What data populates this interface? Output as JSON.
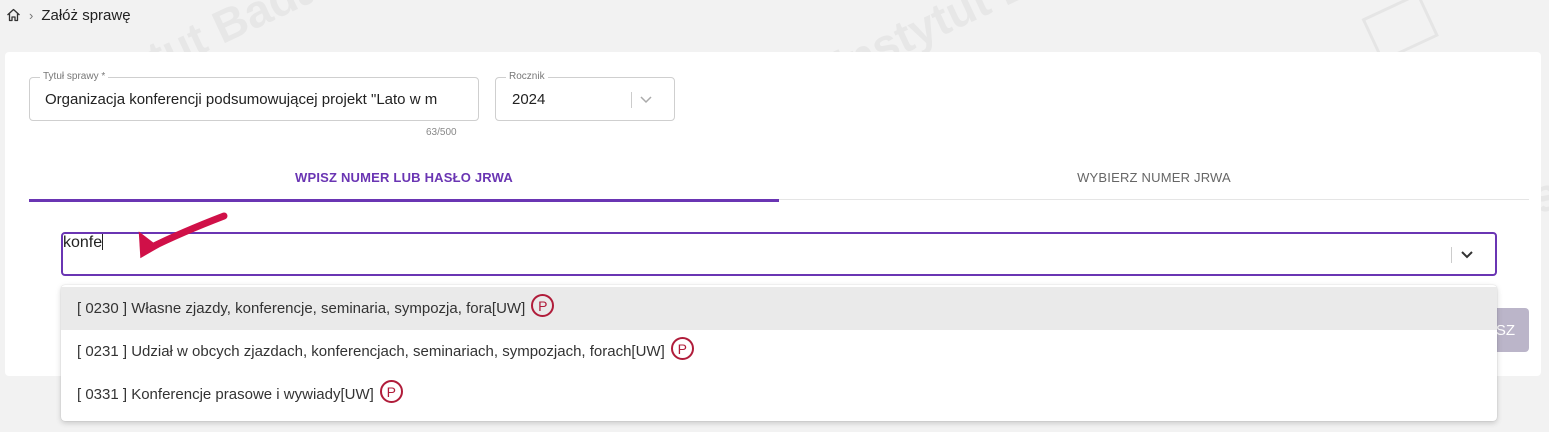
{
  "breadcrumb": {
    "current": "Załóż sprawę"
  },
  "form": {
    "title_label": "Tytuł sprawy *",
    "title_value": "Organizacja konferencji podsumowującej projekt \"Lato w m",
    "title_counter": "63/500",
    "year_label": "Rocznik",
    "year_value": "2024"
  },
  "tabs": [
    {
      "label": "WPISZ NUMER LUB HASŁO JRWA",
      "active": true
    },
    {
      "label": "WYBIERZ NUMER JRWA",
      "active": false
    }
  ],
  "search": {
    "value": "konfe"
  },
  "dropdown": {
    "options": [
      {
        "label": "[ 0230 ] Własne zjazdy, konferencje, seminaria, sympozja, fora[UW]",
        "badge": "P",
        "highlighted": true
      },
      {
        "label": "[ 0231 ] Udział w obcych zjazdach, konferencjach, seminariach, sympozjach, forach[UW]",
        "badge": "P",
        "highlighted": false
      },
      {
        "label": "[ 0331 ] Konferencje prasowe i wywiady[UW]",
        "badge": "P",
        "highlighted": false
      }
    ]
  },
  "hidden_button": {
    "label_fragment": "SZ"
  },
  "colors": {
    "accent": "#6a35b3",
    "badge": "#b01c3a",
    "annotation_arrow": "#d01048"
  },
  "icons": {
    "home": "home-icon",
    "chevron": "chevron-down-icon",
    "arrow": "annotation-arrow-icon"
  }
}
